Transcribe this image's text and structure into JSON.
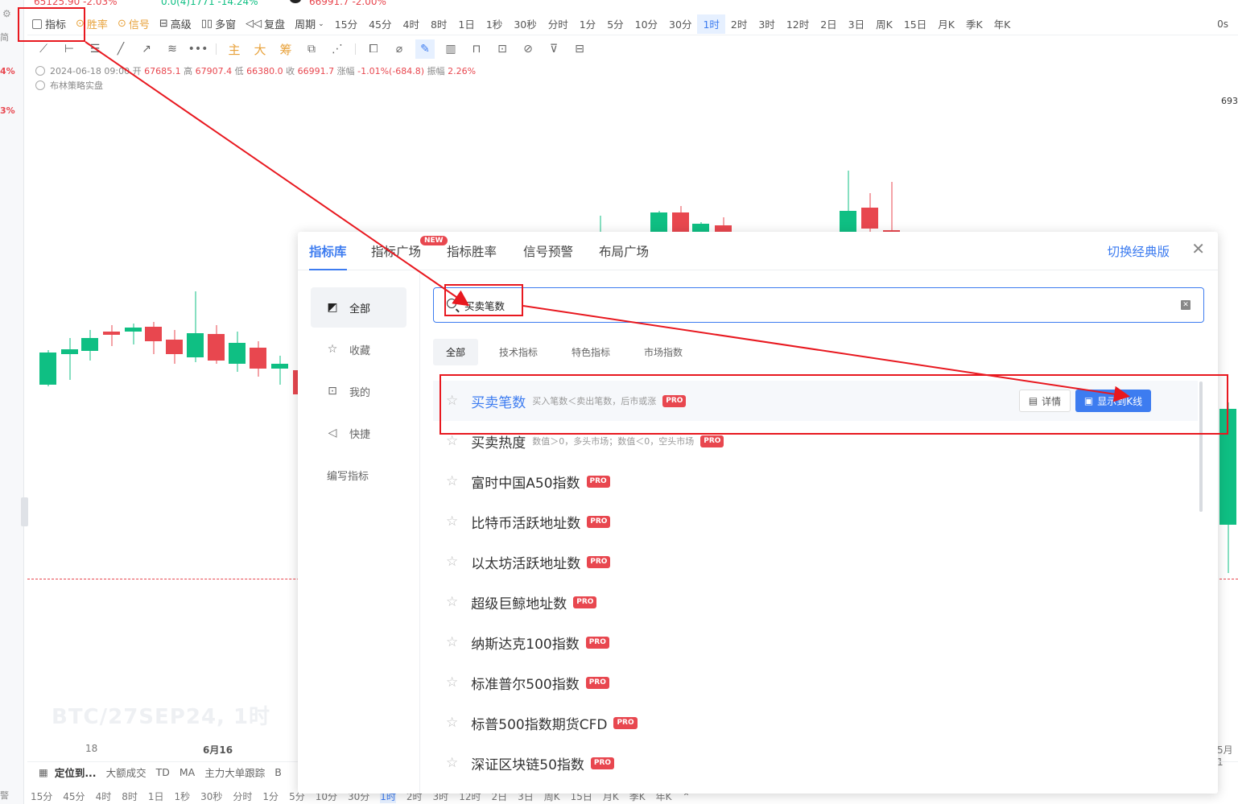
{
  "left_strip": {
    "pct1": "4%",
    "pct2": "3%",
    "label": "简",
    "label_bottom": "警"
  },
  "top_quotes": [
    {
      "text": "65125.90  -2.03%",
      "color": "#e8474f"
    },
    {
      "text": "0.0(4)1771  -14.24%",
      "color": "#0fbf83"
    },
    {
      "text": "66991.7  -2.00%",
      "color": "#e8474f"
    }
  ],
  "toolbar": {
    "indicator": "指标",
    "winrate": "胜率",
    "signal": "信号",
    "advanced": "高级",
    "multiwin": "多窗",
    "replay": "复盘",
    "period": "周期",
    "periods": [
      "15分",
      "45分",
      "4时",
      "8时",
      "1日",
      "1秒",
      "30秒",
      "分时",
      "1分",
      "5分",
      "10分",
      "30分",
      "1时",
      "2时",
      "3时",
      "12时",
      "2日",
      "3日",
      "周K",
      "15日",
      "月K",
      "季K",
      "年K"
    ],
    "active_period": "1时",
    "right_label": "0s"
  },
  "draw_tools_cn": [
    "主",
    "大",
    "筹"
  ],
  "info": {
    "date": "2024-06-18 09:00",
    "open_label": "开",
    "open": "67685.1",
    "high_label": "高",
    "high": "67907.4",
    "low_label": "低",
    "low": "66380.0",
    "close_label": "收",
    "close": "66991.7",
    "change_label": "涨幅",
    "change": "-1.01%(-684.8)",
    "amp_label": "振幅",
    "amp": "2.26%"
  },
  "strategy": "布林策略实盘",
  "price_tag": "693",
  "watermark": "BTC/27SEP24, 1时",
  "x_labels": {
    "a": "18",
    "b": "6月16",
    "c": "5月1"
  },
  "bottom_bar": [
    "定位到...",
    "大额成交",
    "TD",
    "MA",
    "主力大单跟踪",
    "B"
  ],
  "bottom_periods": [
    "15分",
    "45分",
    "4时",
    "8时",
    "1日",
    "1秒",
    "30秒",
    "分时",
    "1分",
    "5分",
    "10分",
    "30分",
    "1时",
    "2时",
    "3时",
    "12时",
    "2日",
    "3日",
    "周K",
    "15日",
    "月K",
    "季K",
    "年K",
    "⌃"
  ],
  "dialog": {
    "tabs": [
      "指标库",
      "指标广场",
      "指标胜率",
      "信号预警",
      "布局广场"
    ],
    "new_badge": "NEW",
    "switch_classic": "切换经典版",
    "close": "✕",
    "side": [
      "全部",
      "收藏",
      "我的",
      "快捷",
      "编写指标"
    ],
    "search_value": "买卖笔数",
    "filters": [
      "全部",
      "技术指标",
      "特色指标",
      "市场指数"
    ],
    "results": [
      {
        "name": "买卖笔数",
        "desc": "买入笔数＜卖出笔数，后市或涨",
        "pro": "PRO"
      },
      {
        "name": "买卖热度",
        "desc": "数值＞0，多头市场；数值＜0，空头市场",
        "pro": "PRO"
      },
      {
        "name": "富时中国A50指数",
        "desc": "",
        "pro": "PRO"
      },
      {
        "name": "比特币活跃地址数",
        "desc": "",
        "pro": "PRO"
      },
      {
        "name": "以太坊活跃地址数",
        "desc": "",
        "pro": "PRO"
      },
      {
        "name": "超级巨鲸地址数",
        "desc": "",
        "pro": "PRO"
      },
      {
        "name": "纳斯达克100指数",
        "desc": "",
        "pro": "PRO"
      },
      {
        "name": "标准普尔500指数",
        "desc": "",
        "pro": "PRO"
      },
      {
        "name": "标普500指数期货CFD",
        "desc": "",
        "pro": "PRO"
      },
      {
        "name": "深证区块链50指数",
        "desc": "",
        "pro": "PRO"
      }
    ],
    "detail_btn": "详情",
    "show_btn": "显示到K线"
  },
  "colors": {
    "accent": "#3d7cf0",
    "up": "#0fbf83",
    "down": "#e8474f",
    "annotation": "#e8181f"
  }
}
